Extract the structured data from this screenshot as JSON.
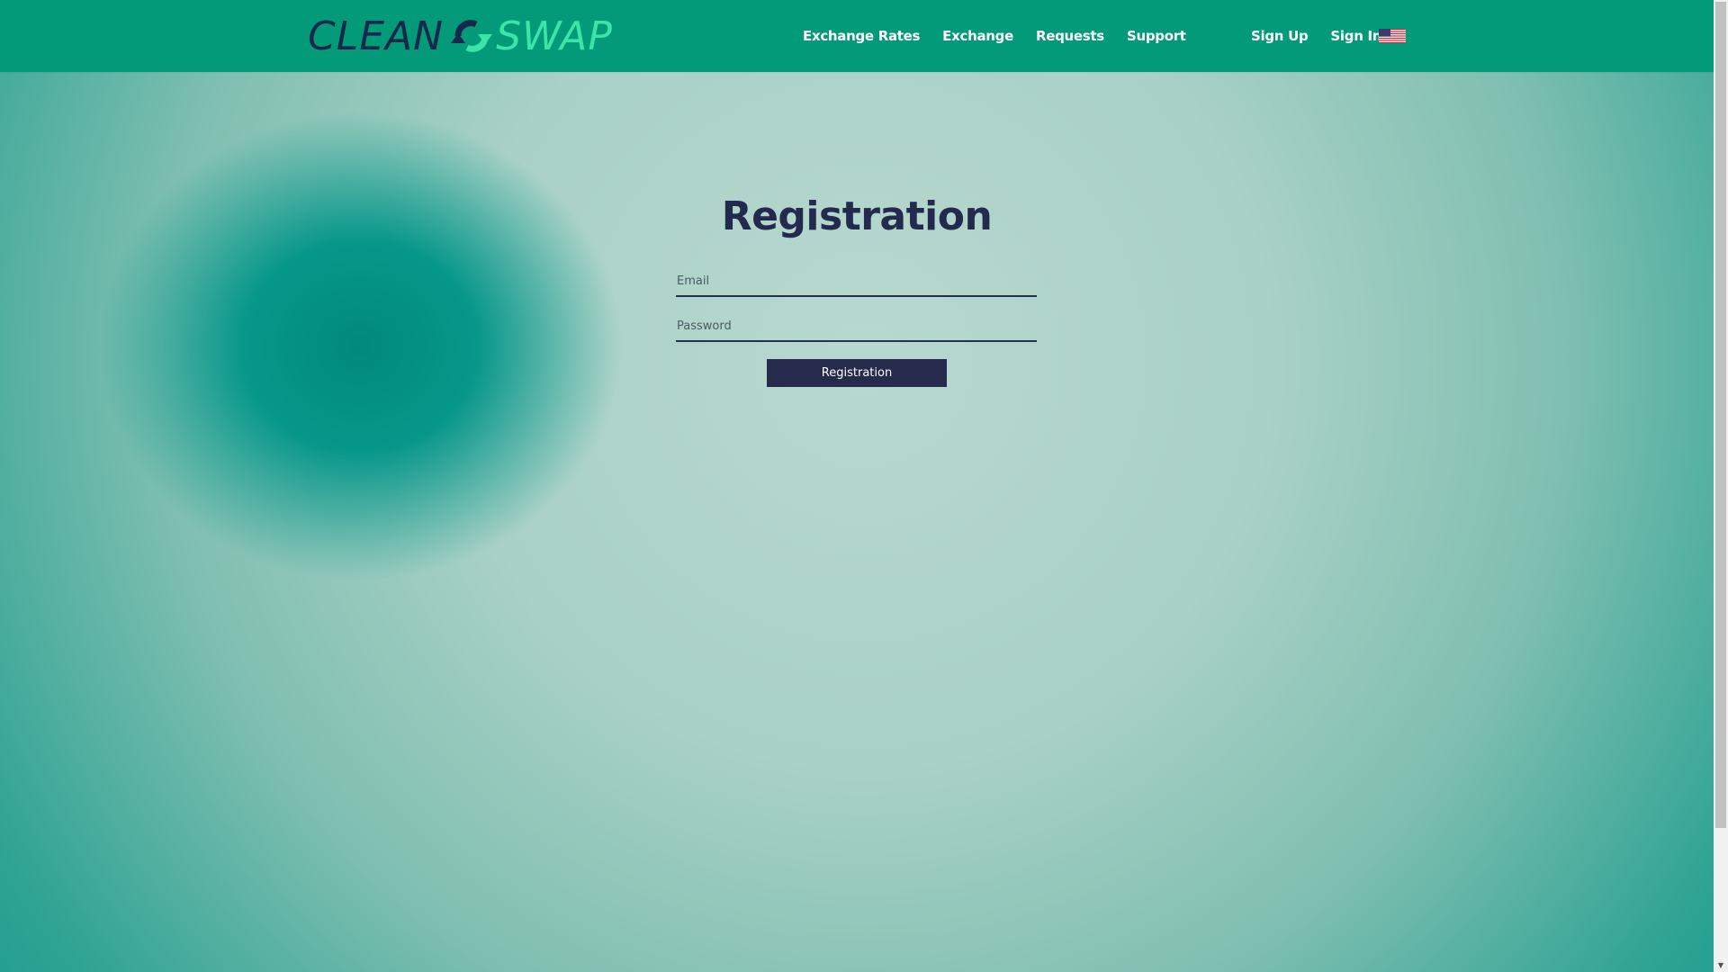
{
  "logo": {
    "part1": "CLEAN",
    "part2": "SWAP",
    "icon": "swap-arrows-icon"
  },
  "nav": {
    "exchange_rates": "Exchange Rates",
    "exchange": "Exchange",
    "requests": "Requests",
    "support": "Support",
    "sign_up": "Sign Up",
    "sign_in": "Sign In",
    "language_icon": "us-flag-icon"
  },
  "form": {
    "title": "Registration",
    "email_placeholder": "Email",
    "password_placeholder": "Password",
    "submit_label": "Registration"
  },
  "colors": {
    "header": "#029a78",
    "brand_dark": "#17294a",
    "brand_light": "#3ee3a7",
    "button": "#262a4c"
  }
}
